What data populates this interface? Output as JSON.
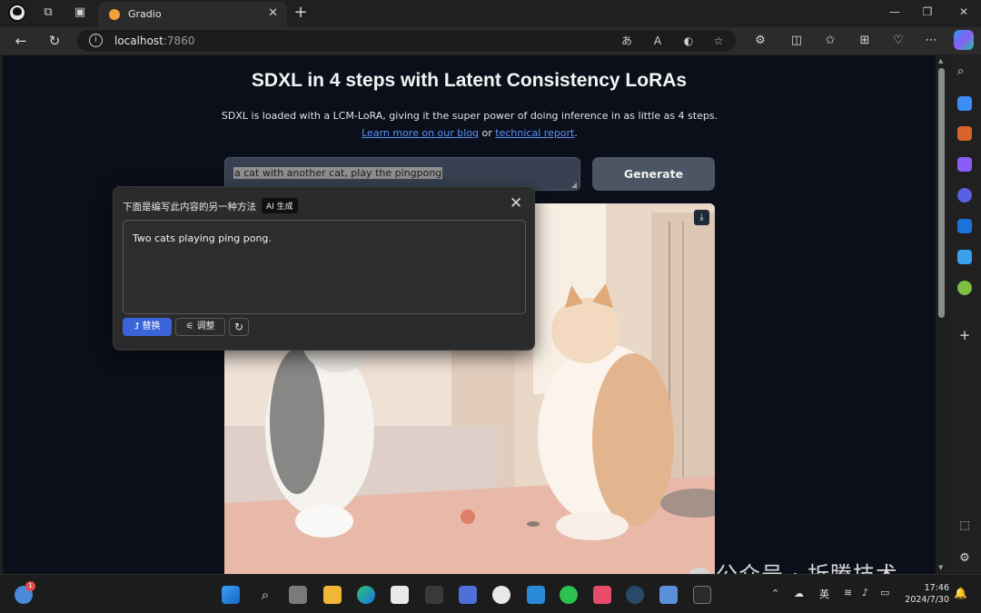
{
  "browser": {
    "tab_title": "Gradio",
    "url_host": "localhost",
    "url_port": ":7860",
    "tab_close": "✕",
    "new_tab": "+",
    "omnibox_icons": [
      "read-aloud-icon",
      "text-size-icon",
      "copilot-icon",
      "favorite-icon"
    ],
    "toolbar_icons": [
      "extensions-icon",
      "split-screen-icon",
      "favorites-icon",
      "collections-icon",
      "browser-essentials-icon",
      "more-icon",
      "copilot-icon"
    ]
  },
  "page": {
    "title": "SDXL in 4 steps with Latent Consistency LoRAs",
    "description_text": "SDXL is loaded with a LCM-LoRA, giving it the super power of doing inference in as little as 4 steps.",
    "link_learn_more": "Learn more on our blog",
    "or_text": "or",
    "link_report": "technical report",
    "period": ".",
    "prompt_value": "a cat with another cat, play the pingpong",
    "generate_label": "Generate",
    "image_alt": "Two cartoon cats playing ping pong"
  },
  "popup": {
    "title": "下面是编写此内容的另一种方法",
    "badge": "AI 生成",
    "close": "✕",
    "rewrite": "Two cats playing ping pong.",
    "replace_label": "替换",
    "adjust_label": "调整"
  },
  "taskbar": {
    "time": "17:46",
    "date": "2024/7/30",
    "ime": "英",
    "notification_count": "1"
  },
  "watermark": "公众号 · 折腾技术",
  "colors": {
    "page_bg": "#0b0f19",
    "accent_blue": "#3a64d8",
    "link": "#5b8ff9",
    "button": "#4b5563"
  }
}
